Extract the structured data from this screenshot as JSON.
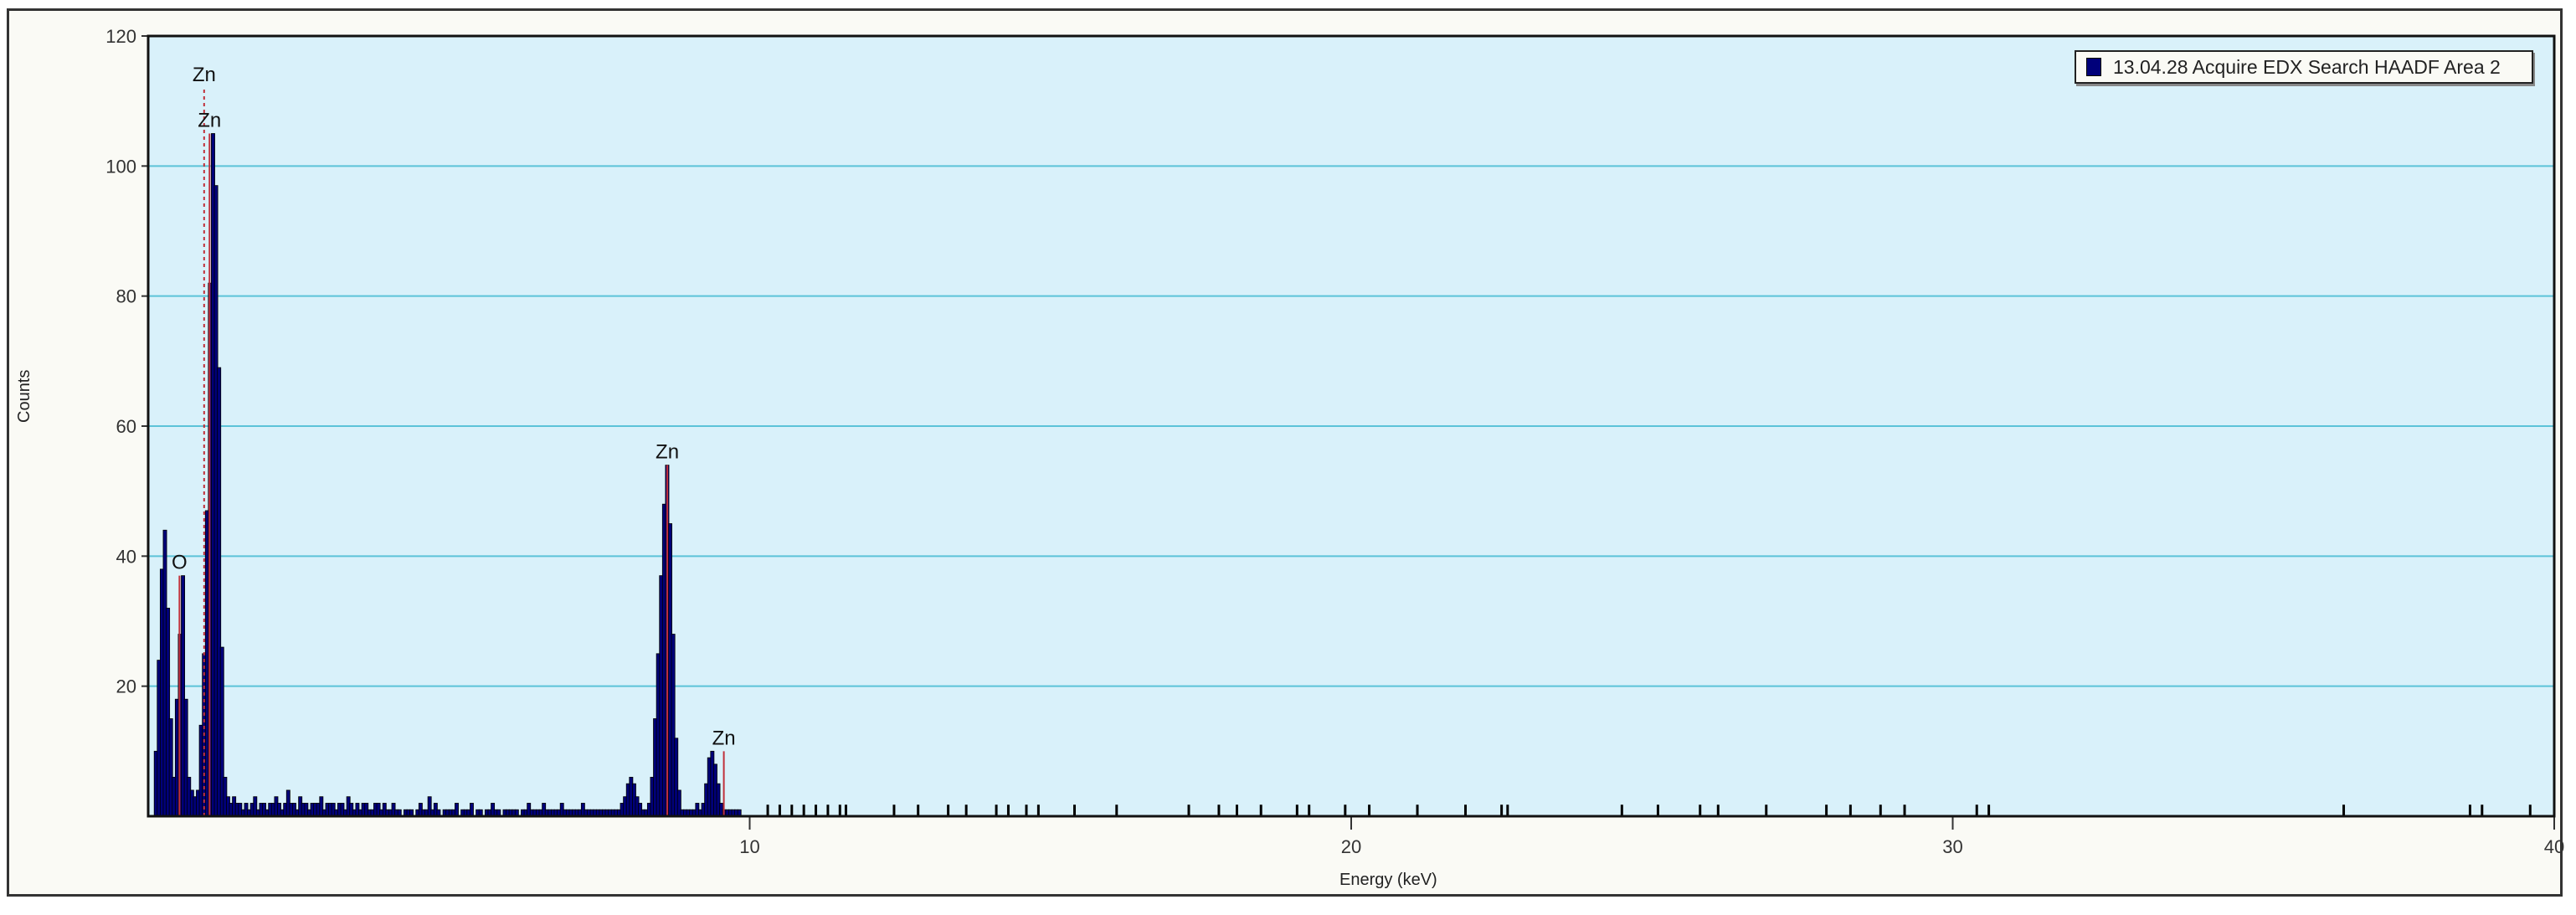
{
  "chart_data": {
    "type": "bar",
    "title": "",
    "xlabel": "Energy (keV)",
    "ylabel": "Counts",
    "xlim": [
      0,
      40
    ],
    "ylim": [
      0,
      120
    ],
    "xticks": [
      "10",
      "20",
      "30",
      "40"
    ],
    "xtick_values": [
      10,
      20,
      30,
      40
    ],
    "yticks": [
      "20",
      "40",
      "60",
      "80",
      "100",
      "120"
    ],
    "ytick_values": [
      20,
      40,
      60,
      80,
      100,
      120
    ],
    "grid": true,
    "legend": {
      "position": "top-right",
      "entries": [
        "13.04.28 Acquire EDX Search HAADF Area 2"
      ]
    },
    "series": [
      {
        "name": "13.04.28 Acquire EDX Search HAADF Area 2",
        "color": "#00007a",
        "bin_width_keV": 0.05,
        "start_keV": 0.0,
        "values": [
          0,
          0,
          10,
          24,
          38,
          44,
          32,
          15,
          6,
          18,
          28,
          37,
          18,
          6,
          4,
          3,
          4,
          14,
          25,
          47,
          82,
          105,
          97,
          69,
          26,
          6,
          3,
          2,
          3,
          2,
          2,
          1,
          2,
          1,
          2,
          3,
          1,
          2,
          2,
          1,
          2,
          2,
          3,
          2,
          1,
          2,
          4,
          2,
          2,
          1,
          3,
          2,
          2,
          1,
          2,
          2,
          2,
          3,
          1,
          2,
          2,
          2,
          1,
          2,
          2,
          1,
          3,
          2,
          1,
          2,
          1,
          2,
          2,
          1,
          1,
          2,
          2,
          1,
          2,
          1,
          1,
          2,
          1,
          1,
          0,
          1,
          1,
          1,
          0,
          1,
          2,
          1,
          1,
          3,
          1,
          2,
          1,
          0,
          1,
          1,
          1,
          1,
          2,
          0,
          1,
          1,
          1,
          2,
          0,
          1,
          1,
          0,
          1,
          1,
          2,
          1,
          1,
          0,
          1,
          1,
          1,
          1,
          1,
          0,
          1,
          1,
          2,
          1,
          1,
          1,
          1,
          2,
          1,
          1,
          1,
          1,
          1,
          2,
          1,
          1,
          1,
          1,
          1,
          1,
          2,
          1,
          1,
          1,
          1,
          1,
          1,
          1,
          1,
          1,
          1,
          1,
          1,
          2,
          3,
          5,
          6,
          5,
          3,
          2,
          1,
          1,
          2,
          6,
          15,
          25,
          37,
          48,
          54,
          45,
          28,
          12,
          4,
          1,
          1,
          1,
          1,
          1,
          2,
          1,
          2,
          5,
          9,
          10,
          8,
          5,
          2,
          1,
          1,
          1,
          1,
          1,
          1
        ]
      },
      {
        "name": "sparse counts above 10 keV (energy, counts)",
        "points": [
          [
            10.3,
            1
          ],
          [
            10.5,
            1
          ],
          [
            10.7,
            1
          ],
          [
            10.9,
            1
          ],
          [
            11.1,
            1
          ],
          [
            11.3,
            1
          ],
          [
            11.5,
            1
          ],
          [
            11.6,
            1
          ],
          [
            12.4,
            1
          ],
          [
            12.8,
            1
          ],
          [
            13.3,
            1
          ],
          [
            13.6,
            1
          ],
          [
            14.1,
            1
          ],
          [
            14.3,
            1
          ],
          [
            14.6,
            1
          ],
          [
            14.8,
            1
          ],
          [
            15.4,
            1
          ],
          [
            16.1,
            1
          ],
          [
            17.3,
            1
          ],
          [
            17.8,
            1
          ],
          [
            18.1,
            1
          ],
          [
            18.5,
            1
          ],
          [
            19.1,
            1
          ],
          [
            19.3,
            1
          ],
          [
            19.9,
            1
          ],
          [
            20.3,
            1
          ],
          [
            21.1,
            1
          ],
          [
            21.9,
            1
          ],
          [
            22.5,
            1
          ],
          [
            22.6,
            1
          ],
          [
            24.5,
            1
          ],
          [
            25.1,
            1
          ],
          [
            25.8,
            1
          ],
          [
            26.1,
            1
          ],
          [
            26.9,
            1
          ],
          [
            27.9,
            1
          ],
          [
            28.3,
            1
          ],
          [
            28.8,
            1
          ],
          [
            29.2,
            1
          ],
          [
            30.4,
            1
          ],
          [
            30.6,
            1
          ],
          [
            36.5,
            1
          ],
          [
            38.6,
            1
          ],
          [
            38.8,
            1
          ],
          [
            39.6,
            1
          ]
        ]
      }
    ],
    "peak_annotations": [
      {
        "label": "Zn",
        "energy": 0.93,
        "counts": 112,
        "style": "dashed"
      },
      {
        "label": "Zn",
        "energy": 1.02,
        "counts": 105,
        "style": "solid"
      },
      {
        "label": "O",
        "energy": 0.52,
        "counts": 37,
        "style": "solid"
      },
      {
        "label": "Zn",
        "energy": 8.63,
        "counts": 54,
        "style": "solid"
      },
      {
        "label": "Zn",
        "energy": 9.57,
        "counts": 10,
        "style": "solid"
      }
    ],
    "colors": {
      "plot_bg": "#d9f1fa",
      "grid": "#5cc3d8",
      "marker_line": "#c0303a",
      "fill": "#00007a"
    }
  }
}
